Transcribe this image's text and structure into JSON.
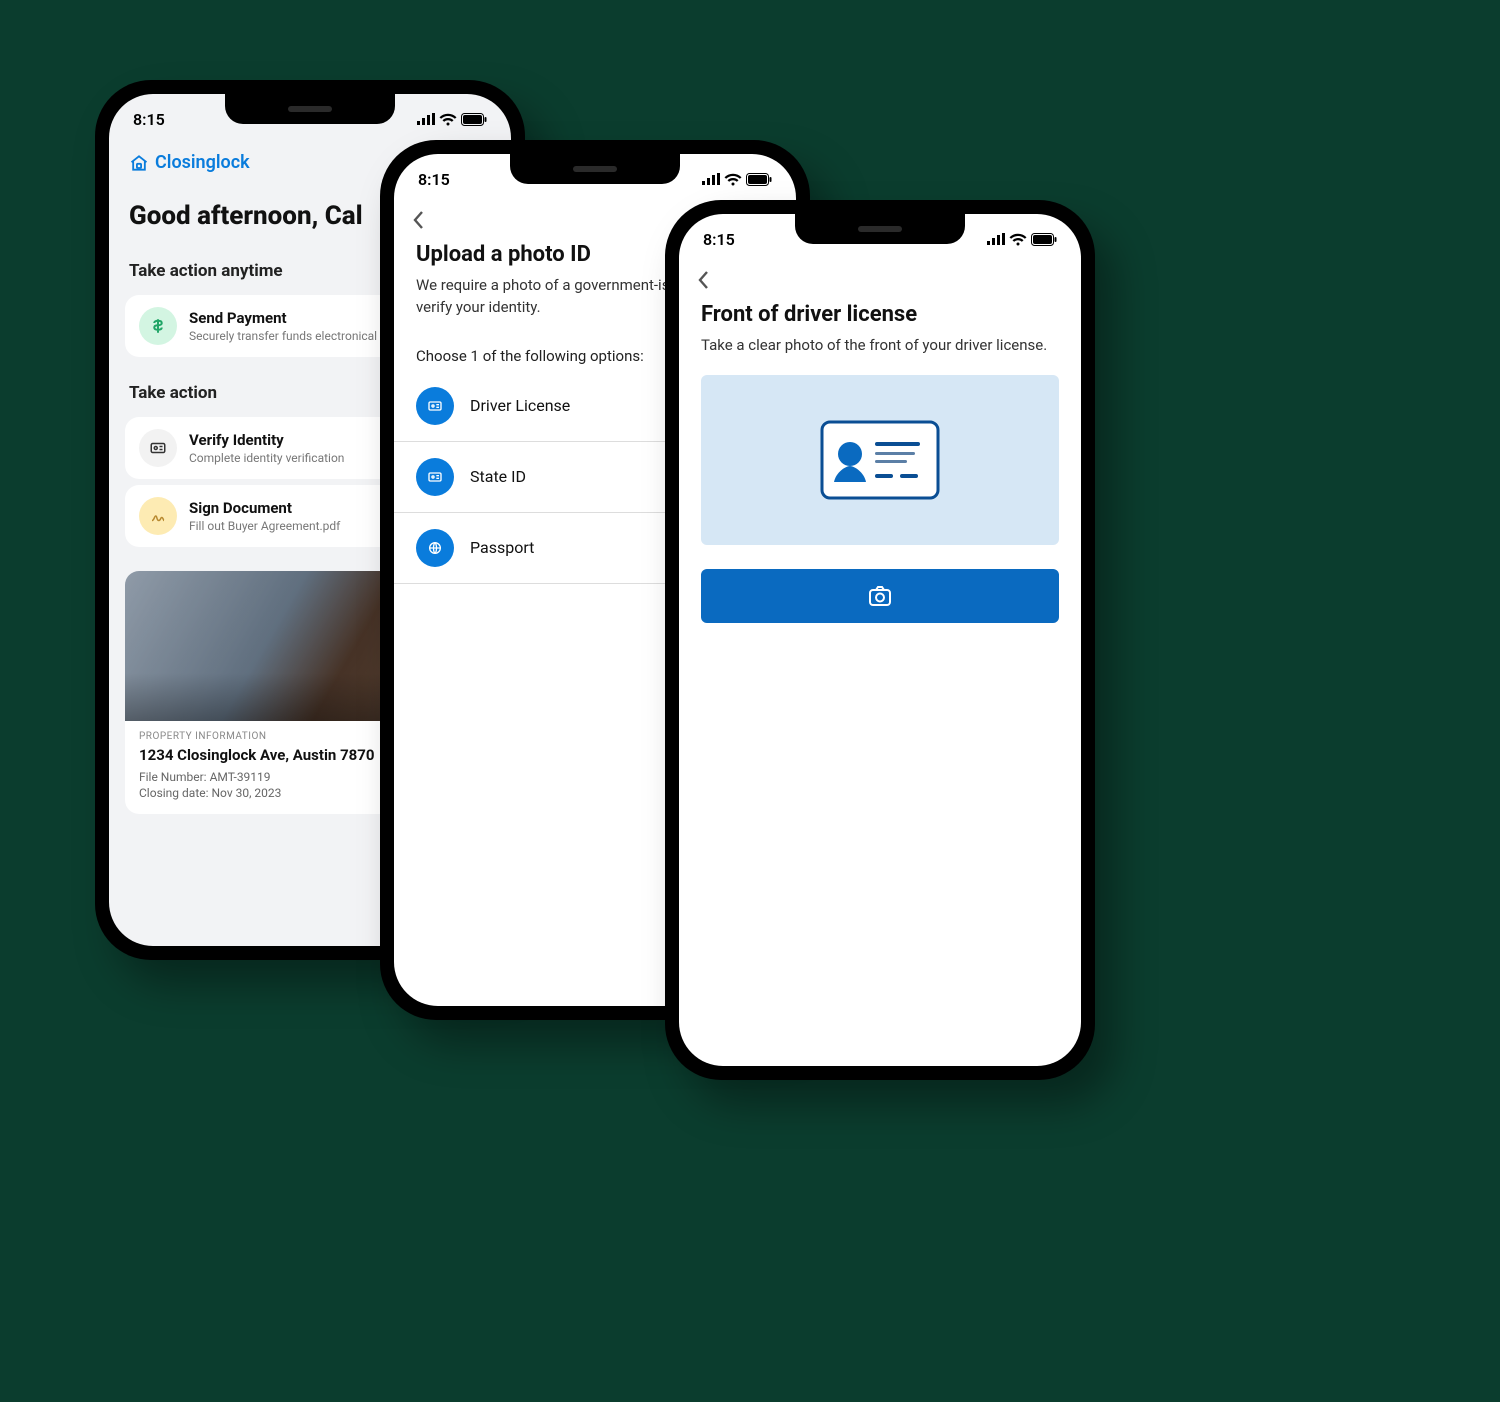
{
  "status": {
    "time": "8:15"
  },
  "brand": {
    "name": "Closinglock"
  },
  "home": {
    "greeting_prefix": "Good afternoon, Cal",
    "section_anytime": "Take action anytime",
    "section_action": "Take action",
    "send_payment": {
      "title": "Send Payment",
      "sub": "Securely transfer funds electronical"
    },
    "verify": {
      "title": "Verify Identity",
      "sub": "Complete identity verification"
    },
    "sign": {
      "title": "Sign Document",
      "sub": "Fill out Buyer Agreement.pdf"
    },
    "property": {
      "label": "PROPERTY INFORMATION",
      "address": "1234 Closinglock Ave, Austin 7870",
      "file_label": "File Number: ",
      "file": "AMT-39119",
      "closing_label": "Closing date: ",
      "closing": "Nov 30, 2023"
    }
  },
  "upload": {
    "title": "Upload a photo ID",
    "body": "We require a photo of a government-issued ID to verify your identity.",
    "choose": "Choose 1 of the following options:",
    "opt_driver": "Driver License",
    "opt_state": "State ID",
    "opt_passport": "Passport"
  },
  "capture": {
    "title": "Front of driver license",
    "body": "Take a clear photo of the front of your driver license."
  }
}
